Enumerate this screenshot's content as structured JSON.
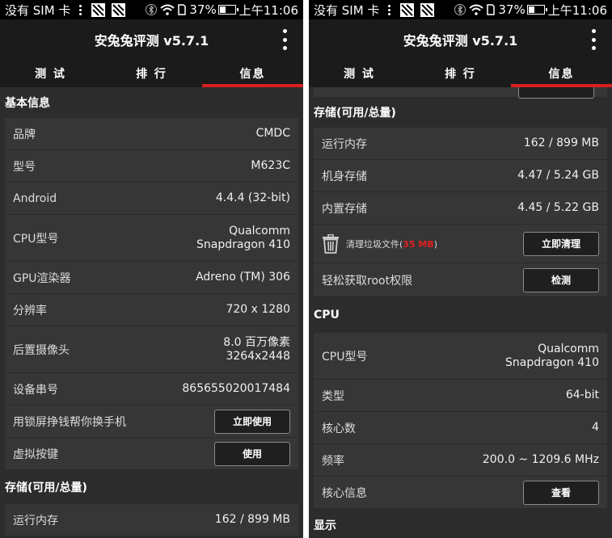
{
  "status_bar": {
    "carrier": "没有 SIM 卡",
    "battery": "37%",
    "battery_level": 0.37,
    "time": "上午11:06"
  },
  "app": {
    "title": "安兔兔评测 v5.7.1"
  },
  "tabs": [
    {
      "label": "测 试"
    },
    {
      "label": "排 行"
    },
    {
      "label": "信息"
    }
  ],
  "left": {
    "basic_header": "基本信息",
    "rows": {
      "brand": {
        "label": "品牌",
        "value": "CMDC"
      },
      "model": {
        "label": "型号",
        "value": "M623C"
      },
      "android": {
        "label": "Android",
        "value": "4.4.4 (32-bit)"
      },
      "cpu": {
        "label": "CPU型号",
        "value_line1": "Qualcomm",
        "value_line2": "Snapdragon 410"
      },
      "gpu": {
        "label": "GPU渲染器",
        "value": "Adreno (TM) 306"
      },
      "resolution": {
        "label": "分辨率",
        "value": "720 x 1280"
      },
      "camera": {
        "label": "后置摄像头",
        "value_line1": "8.0 百万像素",
        "value_line2": "3264x2448"
      },
      "serial": {
        "label": "设备串号",
        "value": "865655020017484"
      },
      "lockscreen": {
        "label": "用锁屏挣钱帮你换手机",
        "button": "立即使用"
      },
      "virtual_keys": {
        "label": "虚拟按键",
        "button": "使用"
      }
    },
    "storage_header": "存储(可用/总量)",
    "storage_ram": {
      "label": "运行内存",
      "value": "162 / 899 MB"
    }
  },
  "right": {
    "storage_header": "存储(可用/总量)",
    "rows": {
      "ram": {
        "label": "运行内存",
        "value": "162 / 899 MB"
      },
      "internal": {
        "label": "机身存储",
        "value": "4.47 / 5.24 GB"
      },
      "builtin": {
        "label": "内置存储",
        "value": "4.45 / 5.22 GB"
      },
      "clean": {
        "label": "清理垃圾文件(",
        "size": "35 MB",
        "suffix": ")",
        "button": "立即清理"
      },
      "root": {
        "label": "轻松获取root权限",
        "button": "检测"
      }
    },
    "cpu_header": "CPU",
    "cpu_rows": {
      "model": {
        "label": "CPU型号",
        "value_line1": "Qualcomm",
        "value_line2": "Snapdragon 410"
      },
      "type": {
        "label": "类型",
        "value": "64-bit"
      },
      "cores": {
        "label": "核心数",
        "value": "4"
      },
      "freq": {
        "label": "频率",
        "value": "200.0 ~ 1209.6 MHz"
      },
      "core_info": {
        "label": "核心信息",
        "button": "查看"
      }
    },
    "display_header": "显示"
  },
  "colors": {
    "background": "#2c2c2c",
    "row": "#363636",
    "bar": "#1b1b1b",
    "accent": "#d81f1f"
  }
}
